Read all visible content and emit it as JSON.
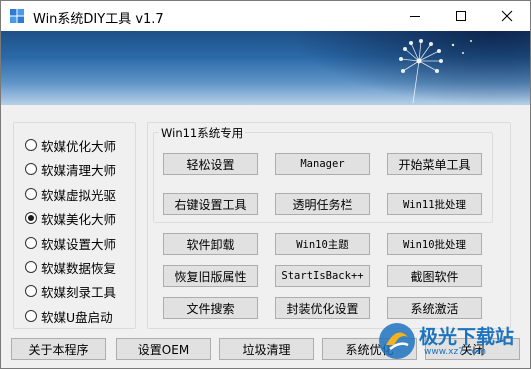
{
  "window": {
    "title": "Win系统DIY工具 v1.7"
  },
  "colors": {
    "accent": "#1e73be",
    "button_bg": "#e1e1e1",
    "button_border": "#adadad"
  },
  "titlebar": {
    "minimize_icon": "minimize-icon",
    "maximize_icon": "maximize-icon",
    "close_icon": "close-icon"
  },
  "left_options": [
    {
      "label": "软媒优化大师",
      "checked": false
    },
    {
      "label": "软媒清理大师",
      "checked": false
    },
    {
      "label": "软媒虚拟光驱",
      "checked": false
    },
    {
      "label": "软媒美化大师",
      "checked": true
    },
    {
      "label": "软媒设置大师",
      "checked": false
    },
    {
      "label": "软媒数据恢复",
      "checked": false
    },
    {
      "label": "软媒刻录工具",
      "checked": false
    },
    {
      "label": "软媒U盘启动",
      "checked": false
    }
  ],
  "win11_group": {
    "legend": "Win11系统专用",
    "buttons": [
      "轻松设置",
      "Manager",
      "开始菜单工具",
      "右键设置工具",
      "透明任务栏",
      "Win11批处理"
    ]
  },
  "tools": {
    "buttons": [
      "软件卸载",
      "Win10主题",
      "Win10批处理",
      "恢复旧版属性",
      "StartIsBack++",
      "截图软件",
      "文件搜索",
      "封装优化设置",
      "系统激活"
    ]
  },
  "bottom_buttons": [
    "关于本程序",
    "设置OEM",
    "垃圾清理",
    "系统优化",
    "关闭"
  ],
  "watermark": {
    "text": "极光下载站",
    "url": "www.xz7.com"
  }
}
